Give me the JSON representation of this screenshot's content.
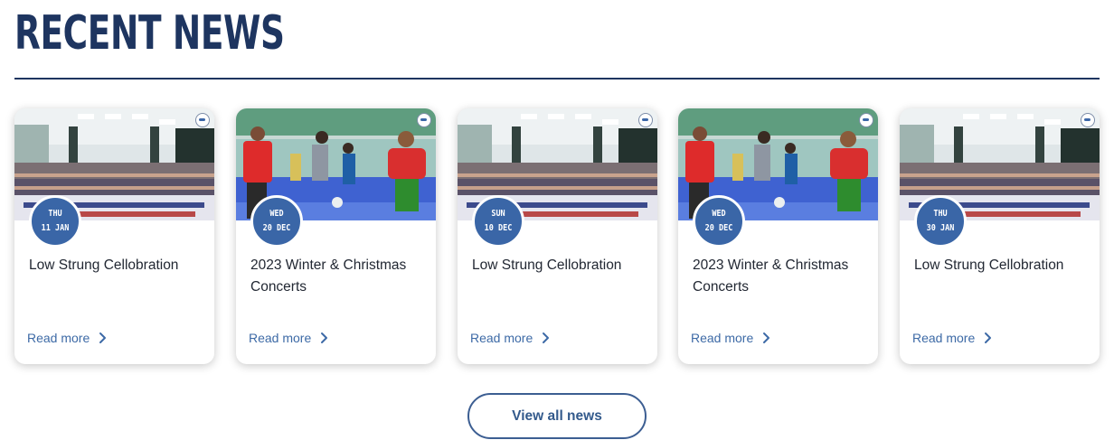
{
  "section": {
    "title": "RECENT NEWS",
    "view_all_label": "View all news"
  },
  "colors": {
    "heading": "#1e3560",
    "accent": "#3a66a7",
    "link": "#3d6aa6"
  },
  "cards": [
    {
      "day": "THU",
      "date": "11 JAN",
      "title": "Low Strung Cellobration",
      "read_more": "Read more",
      "photo": "group-photo-icon"
    },
    {
      "day": "WED",
      "date": "20 DEC",
      "title": "2023 Winter & Christmas Concerts",
      "read_more": "Read more",
      "photo": "christmas-performance-photo-icon"
    },
    {
      "day": "SUN",
      "date": "10 DEC",
      "title": "Low Strung Cellobration",
      "read_more": "Read more",
      "photo": "group-photo-icon"
    },
    {
      "day": "WED",
      "date": "20 DEC",
      "title": "2023 Winter & Christmas Concerts",
      "read_more": "Read more",
      "photo": "christmas-performance-photo-icon"
    },
    {
      "day": "THU",
      "date": "30 JAN",
      "title": "Low Strung Cellobration",
      "read_more": "Read more",
      "photo": "group-photo-icon"
    }
  ]
}
